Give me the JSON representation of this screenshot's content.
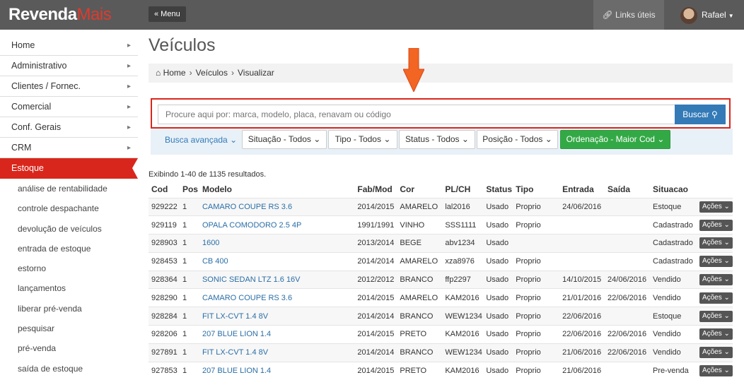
{
  "header": {
    "logo_main": "Revenda",
    "logo_accent": "Mais",
    "menu_label": "« Menu",
    "links_label": "Links úteis",
    "user_name": "Rafael"
  },
  "sidebar": {
    "items": [
      {
        "label": "Home"
      },
      {
        "label": "Administrativo"
      },
      {
        "label": "Clientes / Fornec."
      },
      {
        "label": "Comercial"
      },
      {
        "label": "Conf. Gerais"
      },
      {
        "label": "CRM"
      },
      {
        "label": "Estoque"
      }
    ],
    "subitems": [
      "análise de rentabilidade",
      "controle despachante",
      "devolução de veículos",
      "entrada de estoque",
      "estorno",
      "lançamentos",
      "liberar pré-venda",
      "pesquisar",
      "pré-venda",
      "saída de estoque"
    ]
  },
  "page": {
    "title": "Veículos",
    "breadcrumb": [
      "Home",
      "Veículos",
      "Visualizar"
    ]
  },
  "search": {
    "placeholder": "Procure aqui por: marca, modelo, placa, renavam ou código",
    "button_label": "Buscar"
  },
  "filters": {
    "advanced_label": "Busca avançada",
    "situacao": "Situação - Todos",
    "tipo": "Tipo - Todos",
    "status": "Status - Todos",
    "posicao": "Posição - Todos",
    "ordenacao": "Ordenação - Maior Cod"
  },
  "results_text": "Exibindo 1-40 de 1135 resultados.",
  "table": {
    "headers": [
      "Cod",
      "Pos",
      "Modelo",
      "Fab/Mod",
      "Cor",
      "PL/CH",
      "Status",
      "Tipo",
      "Entrada",
      "Saída",
      "Situacao",
      ""
    ],
    "action_label": "Ações",
    "rows": [
      [
        "929222",
        "1",
        "CAMARO COUPE RS 3.6",
        "2014/2015",
        "AMARELO",
        "lal2016",
        "Usado",
        "Proprio",
        "24/06/2016",
        "",
        "Estoque"
      ],
      [
        "929119",
        "1",
        "OPALA COMODORO 2.5 4P",
        "1991/1991",
        "VINHO",
        "SSS1111",
        "Usado",
        "Proprio",
        "",
        "",
        "Cadastrado"
      ],
      [
        "928903",
        "1",
        "1600",
        "2013/2014",
        "BEGE",
        "abv1234",
        "Usado",
        "",
        "",
        "",
        "Cadastrado"
      ],
      [
        "928453",
        "1",
        "CB 400",
        "2014/2014",
        "AMARELO",
        "xza8976",
        "Usado",
        "Proprio",
        "",
        "",
        "Cadastrado"
      ],
      [
        "928364",
        "1",
        "SONIC SEDAN LTZ 1.6 16V",
        "2012/2012",
        "BRANCO",
        "ffp2297",
        "Usado",
        "Proprio",
        "14/10/2015",
        "24/06/2016",
        "Vendido"
      ],
      [
        "928290",
        "1",
        "CAMARO COUPE RS 3.6",
        "2014/2015",
        "AMARELO",
        "KAM2016",
        "Usado",
        "Proprio",
        "21/01/2016",
        "22/06/2016",
        "Vendido"
      ],
      [
        "928284",
        "1",
        "FIT LX-CVT 1.4 8V",
        "2014/2014",
        "BRANCO",
        "WEW1234",
        "Usado",
        "Proprio",
        "22/06/2016",
        "",
        "Estoque"
      ],
      [
        "928206",
        "1",
        "207 BLUE LION 1.4",
        "2014/2015",
        "PRETO",
        "KAM2016",
        "Usado",
        "Proprio",
        "22/06/2016",
        "22/06/2016",
        "Vendido"
      ],
      [
        "927891",
        "1",
        "FIT LX-CVT 1.4 8V",
        "2014/2014",
        "BRANCO",
        "WEW1234",
        "Usado",
        "Proprio",
        "21/06/2016",
        "22/06/2016",
        "Vendido"
      ],
      [
        "927853",
        "1",
        "207 BLUE LION 1.4",
        "2014/2015",
        "PRETO",
        "KAM2016",
        "Usado",
        "Proprio",
        "21/06/2016",
        "",
        "Pre-venda"
      ]
    ]
  },
  "colors": {
    "accent_red": "#d9261c",
    "primary_blue": "#337ab7",
    "success_green": "#33a946",
    "topbar": "#5a5a5a"
  }
}
